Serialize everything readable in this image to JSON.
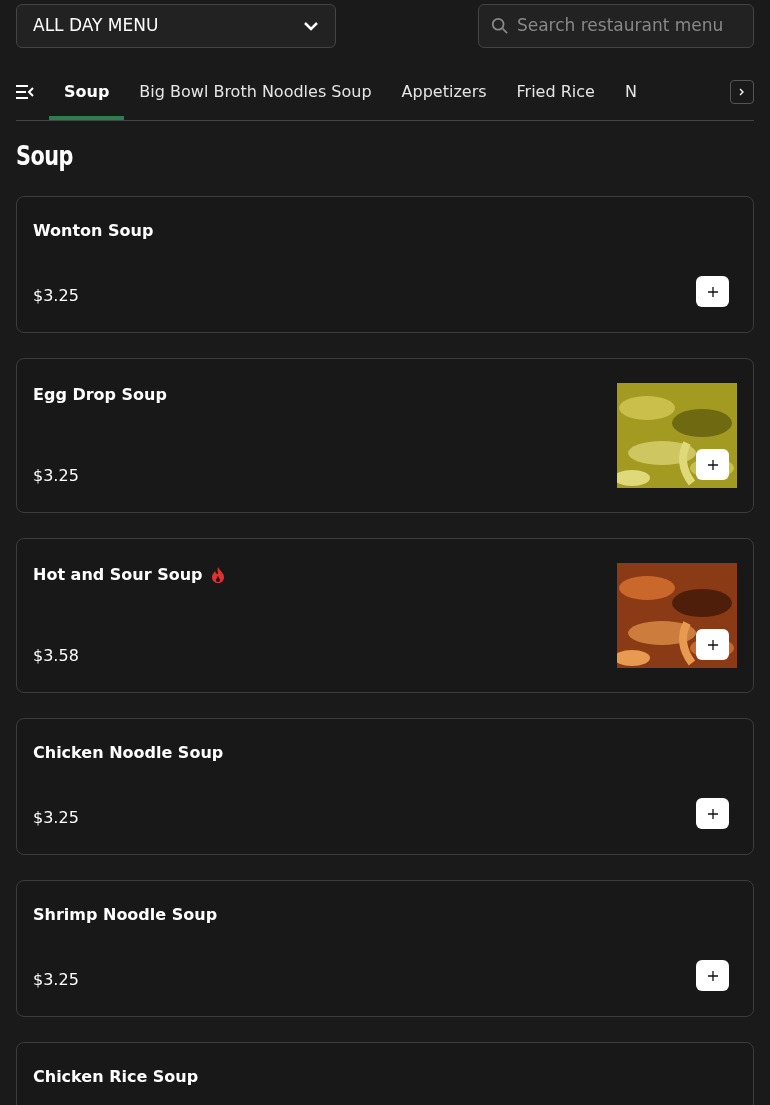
{
  "menu_select": {
    "value": "ALL DAY MENU"
  },
  "search": {
    "placeholder": "Search restaurant menu"
  },
  "tabs": [
    {
      "label": "Soup",
      "selected": true
    },
    {
      "label": "Big Bowl Broth Noodles Soup",
      "selected": false
    },
    {
      "label": "Appetizers",
      "selected": false
    },
    {
      "label": "Fried Rice",
      "selected": false
    },
    {
      "label": "N",
      "selected": false
    }
  ],
  "section_title": "Soup",
  "items": [
    {
      "name": "Wonton Soup",
      "price": "$3.25",
      "spicy": false
    },
    {
      "name": "Egg Drop Soup",
      "price": "$3.25",
      "spicy": false
    },
    {
      "name": "Hot and Sour Soup",
      "price": "$3.58",
      "spicy": true
    },
    {
      "name": "Chicken Noodle Soup",
      "price": "$3.25",
      "spicy": false
    },
    {
      "name": "Shrimp Noodle Soup",
      "price": "$3.25",
      "spicy": false
    },
    {
      "name": "Chicken Rice Soup",
      "spicy": false
    }
  ]
}
